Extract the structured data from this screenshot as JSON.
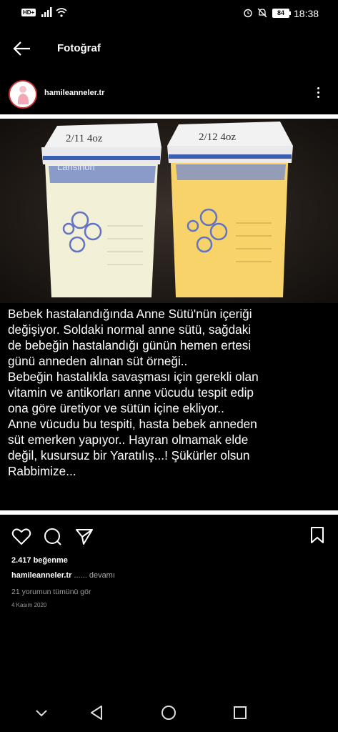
{
  "status_bar": {
    "network_badge": "HD+",
    "battery_level": "84",
    "time": "18:38"
  },
  "header": {
    "title": "Fotoğraf"
  },
  "profile": {
    "username": "hamileanneler.tr"
  },
  "post": {
    "caption_lines": [
      "Bebek hastalandığında Anne Sütü'nün içeriği",
      "değişiyor. Soldaki normal anne sütü, sağdaki",
      "de bebeğin hastalandığı günün hemen ertesi",
      "günü anneden alınan süt örneği..",
      "Bebeğin hastalıkla savaşması için gerekli olan",
      "vitamin ve antikorları anne vücudu tespit edip",
      "ona göre üretiyor ve sütün içine ekliyor..",
      "Anne vücudu bu tespiti, hasta bebek anneden",
      "süt emerken yapıyor.. Hayran olmamak elde",
      "değil, kusursuz bir Yaratılış...! Şükürler olsun",
      "Rabbimize..."
    ],
    "photo": {
      "left_bag_label": "Lansinoh",
      "left_bag_handwriting": "2/11 4oz",
      "right_bag_handwriting": "2/12 4oz"
    }
  },
  "engagement": {
    "likes": "2.417 beğenme",
    "caption_user": "hamileanneler.tr",
    "caption_more": "...... devamı",
    "comments_link": "21 yorumun tümünü gör",
    "date": "4 Kasım 2020"
  },
  "colors": {
    "background": "#000000",
    "text": "#ffffff",
    "muted": "#9a9a9a",
    "milk_left": "#f3f0d8",
    "milk_right": "#f7d36a",
    "bag_zip": "#3a5fb0"
  },
  "icons": {
    "back": "arrow-left-icon",
    "more": "vertical-dots-icon",
    "like": "heart-icon",
    "comment": "speech-bubble-icon",
    "share": "paper-plane-icon",
    "save": "bookmark-icon",
    "nav_down": "chevron-down-icon",
    "nav_back": "triangle-back-icon",
    "nav_home": "circle-home-icon",
    "nav_recent": "square-recent-icon"
  }
}
